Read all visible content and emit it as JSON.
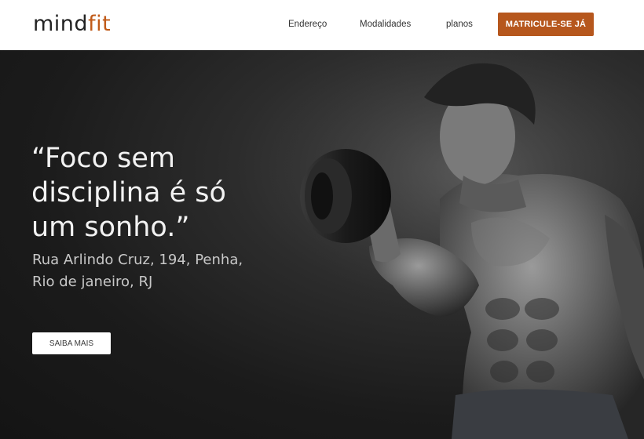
{
  "header": {
    "logo_main": "mind",
    "logo_accent": "fit",
    "nav": [
      {
        "label": "Endereço"
      },
      {
        "label": "Modalidades"
      },
      {
        "label": "planos"
      }
    ],
    "cta_label": "MATRICULE-SE JÁ"
  },
  "hero": {
    "quote_lines": [
      "“Foco sem",
      "disciplina é só",
      "um sonho.”"
    ],
    "address_lines": [
      "Rua Arlindo Cruz, 194, Penha,",
      "Rio de janeiro, RJ"
    ],
    "button_label": "SAIBA MAIS",
    "image": "bodybuilder-dumbbell-curl-photo"
  },
  "colors": {
    "accent": "#c05a18",
    "cta_background": "#b6571d",
    "header_background": "#ffffff",
    "hero_background": "#1b1b1b"
  }
}
